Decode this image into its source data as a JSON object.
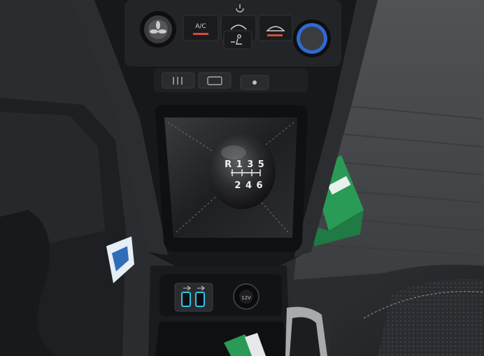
{
  "hvac": {
    "ac_label": "A/C",
    "fan_icon": "fan-icon",
    "recirculation_icon": "recirculation-icon",
    "airflow_icon": "airflow-person-icon",
    "windshield_icon": "windshield-defrost-icon",
    "power_icon": "power-icon",
    "seat_heat_icon": "seat-heater-icon",
    "rear_defrost_icon": "rear-defrost-icon",
    "indicator_color": "#d94a3a"
  },
  "gear_knob": {
    "top_row": "R 1 3 5",
    "bottom_row": "2 4 6",
    "label_color": "#f2f2f2"
  },
  "console": {
    "usb_icon": "usb-icon",
    "usb_port_color": "#2ec4e6",
    "power_socket_label": "12V"
  },
  "colors": {
    "trim": "#1c1c1e",
    "seat": "#2a2b2e",
    "green_box": "#2a9a57"
  }
}
